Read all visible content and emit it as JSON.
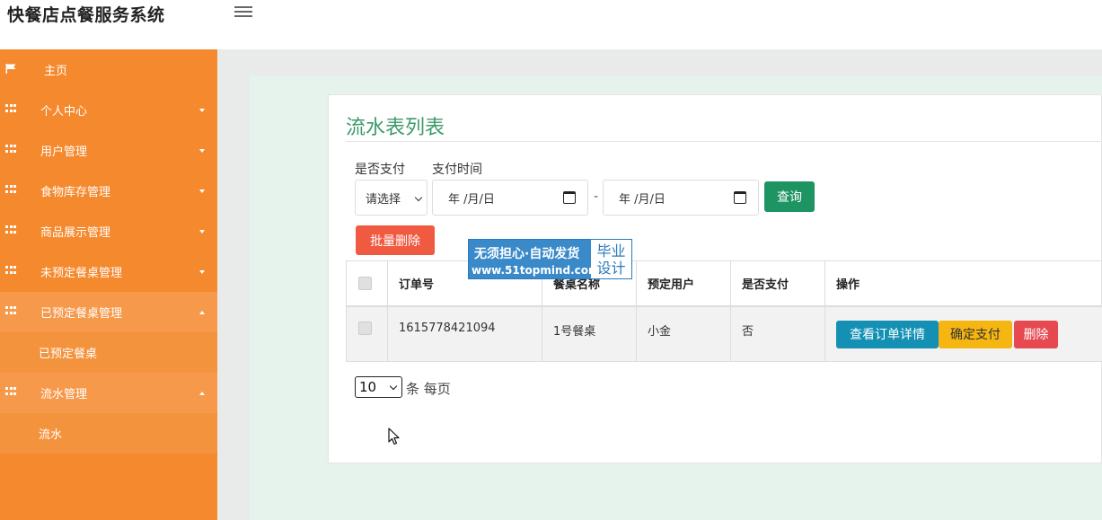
{
  "app": {
    "title": "快餐店点餐服务系统"
  },
  "sidebar": {
    "items": [
      {
        "label": "主页",
        "icon": "flag-icon"
      },
      {
        "label": "个人中心",
        "icon": "grid-icon"
      },
      {
        "label": "用户管理",
        "icon": "grid-icon"
      },
      {
        "label": "食物库存管理",
        "icon": "grid-icon"
      },
      {
        "label": "商品展示管理",
        "icon": "grid-icon"
      },
      {
        "label": "未预定餐桌管理",
        "icon": "grid-icon"
      },
      {
        "label": "已预定餐桌管理",
        "icon": "grid-icon",
        "expanded": true,
        "children": [
          "已预定餐桌"
        ]
      },
      {
        "label": "流水管理",
        "icon": "grid-icon",
        "expanded": true,
        "children": [
          "流水"
        ]
      }
    ]
  },
  "page": {
    "title": "流水表列表",
    "filters": {
      "paid_label": "是否支付",
      "time_label": "支付时间",
      "select_value": "请选择",
      "date_from": "年 /月/日",
      "date_to": "年 /月/日",
      "dash": "-",
      "query_button": "查询"
    },
    "batch_delete_button": "批量删除"
  },
  "watermark": {
    "line1": "无须担心·自动发货",
    "line2": "www.51topmind.com",
    "right1": "毕业",
    "right2": "设计"
  },
  "table": {
    "columns": [
      "订单号",
      "餐桌名称",
      "预定用户",
      "是否支付",
      "操作"
    ],
    "rows": [
      {
        "order_no": "1615778421094",
        "table_name": "1号餐桌",
        "user": "小金",
        "paid": "否",
        "actions": [
          "查看订单详情",
          "确定支付",
          "删除"
        ]
      }
    ]
  },
  "pager": {
    "page_size": "10",
    "suffix": "条 每页"
  },
  "colors": {
    "sidebar": "#f5892e",
    "sidebar_active": "#f7994a",
    "title_green": "#3e9a6a",
    "query_green": "#1f9463",
    "batch_red": "#f05a41",
    "detail_blue": "#1490b4",
    "pay_yellow": "#f6b611",
    "delete_red": "#e64950"
  }
}
